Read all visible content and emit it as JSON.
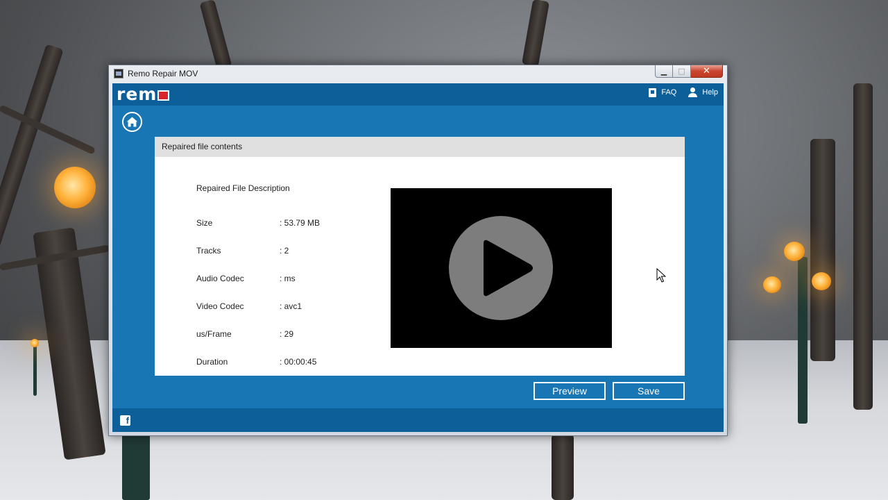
{
  "window": {
    "title": "Remo Repair MOV",
    "controls": {
      "minimize": "▁",
      "maximize": "□",
      "close": "✕"
    }
  },
  "header": {
    "logo_text": "rem",
    "faq_label": "FAQ",
    "help_label": "Help"
  },
  "panel": {
    "header_title": "Repaired file contents",
    "description_title": "Repaired File Description",
    "fields": [
      {
        "label": "Size",
        "value": ": 53.79 MB"
      },
      {
        "label": "Tracks",
        "value": ": 2"
      },
      {
        "label": "Audio Codec",
        "value": ": ms"
      },
      {
        "label": "Video Codec",
        "value": ": avc1"
      },
      {
        "label": "us/Frame",
        "value": ": 29"
      },
      {
        "label": "Duration",
        "value": ": 00:00:45"
      }
    ]
  },
  "actions": {
    "preview_label": "Preview",
    "save_label": "Save"
  },
  "footer": {
    "facebook_glyph": "f"
  },
  "icons": {
    "home": "home-icon",
    "faq": "faq-book-icon",
    "help": "user-help-icon",
    "play": "play-icon",
    "facebook": "facebook-icon"
  },
  "colors": {
    "app_blue": "#1976b5",
    "bar_blue": "#0d5f99",
    "logo_red": "#d9232d",
    "panel_header": "#e0e0e0",
    "video_bg": "#000000",
    "play_circle": "#7d7d7d"
  }
}
